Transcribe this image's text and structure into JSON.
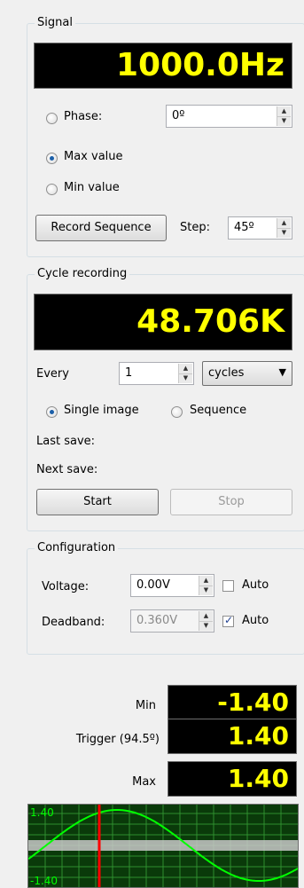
{
  "signal": {
    "title": "Signal",
    "frequency_display": "1000.0Hz",
    "phase_label": "Phase:",
    "phase_value": "0º",
    "max_value_label": "Max value",
    "min_value_label": "Min value",
    "selected_mode": "Max value",
    "record_sequence_label": "Record Sequence",
    "step_label": "Step:",
    "step_value": "45º"
  },
  "cycle_recording": {
    "title": "Cycle recording",
    "count_display": "48.706K",
    "every_label": "Every",
    "every_value": "1",
    "unit_selected": "cycles",
    "single_image_label": "Single image",
    "sequence_label": "Sequence",
    "selected_mode": "Single image",
    "last_save_label": "Last save:",
    "next_save_label": "Next save:",
    "start_label": "Start",
    "stop_label": "Stop"
  },
  "configuration": {
    "title": "Configuration",
    "voltage_label": "Voltage:",
    "voltage_value": "0.00V",
    "voltage_auto_label": "Auto",
    "voltage_auto_checked": false,
    "deadband_label": "Deadband:",
    "deadband_value": "0.360V",
    "deadband_auto_label": "Auto",
    "deadband_auto_checked": true
  },
  "readouts": {
    "min_label": "Min",
    "min_value": "-1.40",
    "trigger_label": "Trigger (94.5º)",
    "trigger_value": "1.40",
    "max_label": "Max",
    "max_value": "1.40"
  },
  "waveform": {
    "top_label": "1.40",
    "bottom_label": "-1.40",
    "colors": {
      "background": "#0a3a0a",
      "grid": "#2f8f2f",
      "wave": "#00ff00",
      "cursor": "#ff0000",
      "band": "#c8c8c8"
    }
  },
  "colors": {
    "lcd_text": "#ffff00",
    "lcd_background": "#000000"
  }
}
